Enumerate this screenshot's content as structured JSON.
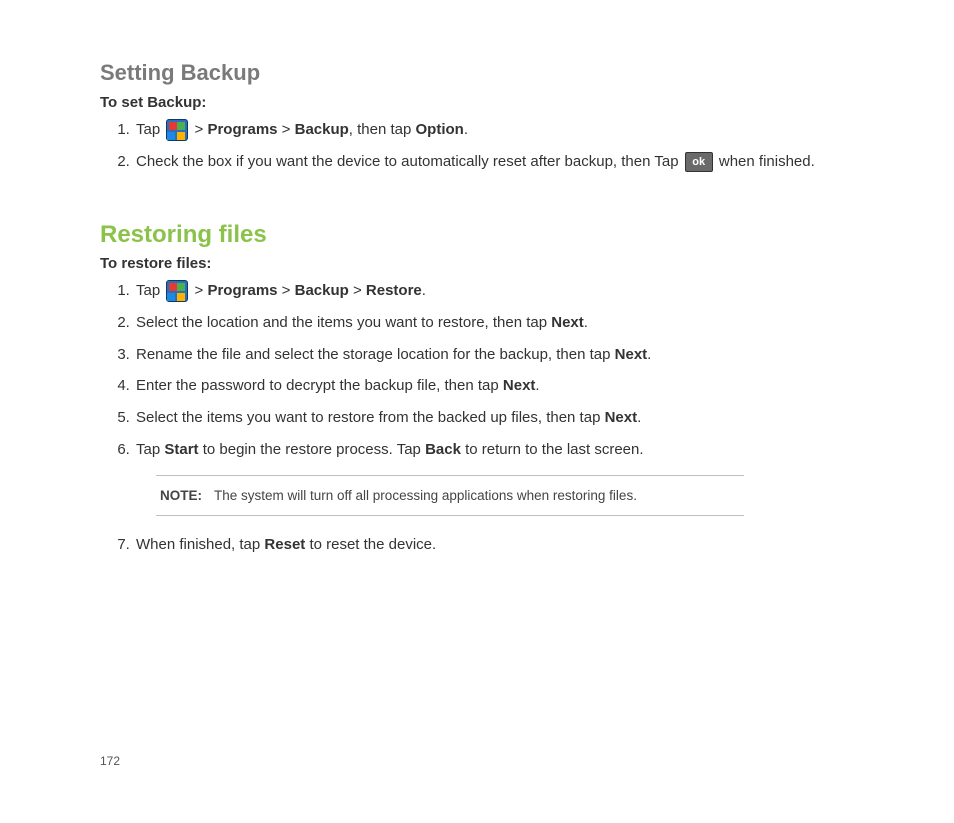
{
  "section1": {
    "heading": "Setting Backup",
    "subhead": "To set Backup:",
    "steps": {
      "s1": {
        "tap": "Tap ",
        "gt1": " > ",
        "programs": "Programs",
        "gt2": " > ",
        "backup": "Backup",
        "then": ", then tap ",
        "option": "Option",
        "period": "."
      },
      "s2": {
        "pre": "Check the box if you want the device to automatically reset after backup, then Tap ",
        "post": " when finished."
      }
    }
  },
  "section2": {
    "heading": "Restoring files",
    "subhead": "To restore files:",
    "steps": {
      "s1": {
        "tap": "Tap ",
        "gt1": " > ",
        "programs": "Programs",
        "gt2": " > ",
        "backup": "Backup",
        "gt3": " > ",
        "restore": "Restore",
        "period": "."
      },
      "s2": {
        "pre": "Select the location and the items you want to restore, then tap ",
        "next": "Next",
        "period": "."
      },
      "s3": {
        "pre": "Rename the file and select the storage location for the backup, then tap ",
        "next": "Next",
        "period": "."
      },
      "s4": {
        "pre": "Enter the password to decrypt the backup file, then tap ",
        "next": "Next",
        "period": "."
      },
      "s5": {
        "pre": "Select the items you want to restore from the backed up files, then tap ",
        "next": "Next",
        "period": "."
      },
      "s6": {
        "t1": "Tap ",
        "start": "Start",
        "t2": " to begin the restore process. Tap ",
        "back": "Back",
        "t3": " to return to the last screen."
      },
      "s7": {
        "pre": "When finished, tap ",
        "reset": "Reset",
        "post": " to reset the device."
      }
    },
    "note": {
      "label": "NOTE:",
      "text": "The system will turn off all processing applications when restoring files."
    }
  },
  "icons": {
    "ok_text": "ok"
  },
  "page_number": "172"
}
